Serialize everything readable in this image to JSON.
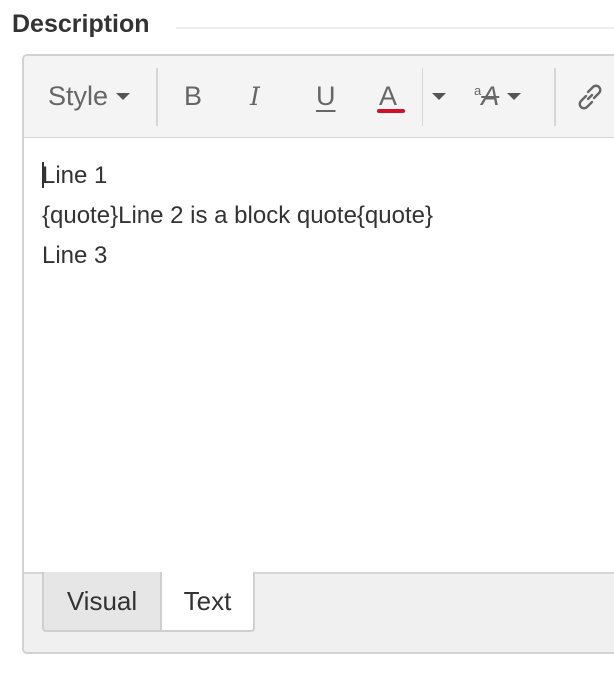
{
  "field": {
    "label": "Description"
  },
  "toolbar": {
    "style_label": "Style",
    "bold_label": "B",
    "italic_label": "I",
    "underline_label": "U",
    "color_label": "A",
    "text_color_accent": "#d0112b",
    "font_size_sup": "a",
    "font_size_label": "A"
  },
  "content": {
    "lines": [
      "Line 1",
      "{quote}Line 2 is a block quote{quote}",
      "Line 3"
    ]
  },
  "tabs": [
    {
      "label": "Visual",
      "active": false
    },
    {
      "label": "Text",
      "active": true
    }
  ]
}
